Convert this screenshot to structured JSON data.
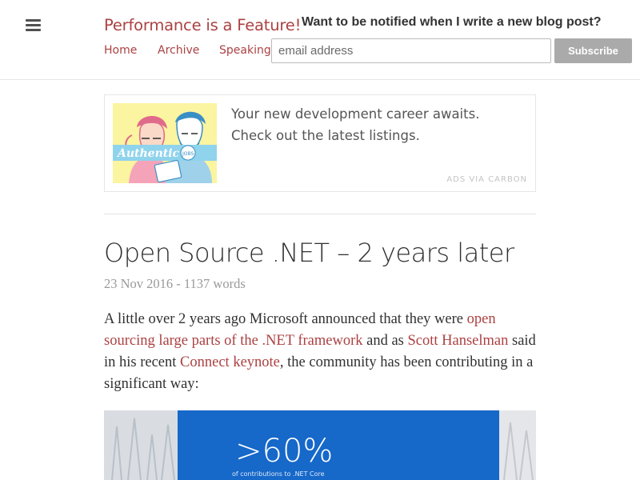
{
  "header": {
    "site_title": "Performance is a Feature!",
    "nav": [
      "Home",
      "Archive",
      "Speaking"
    ],
    "notify_question": "Want to be notified when I write a new blog post?",
    "email_placeholder": "email address",
    "subscribe_label": "Subscribe"
  },
  "ad": {
    "image_logo_text": "Authentic",
    "image_badge_text": "JOBS",
    "text": "Your new development career awaits. Check out the latest listings.",
    "via": "ADS VIA CARBON"
  },
  "post": {
    "title": "Open Source .NET – 2 years later",
    "meta": "23 Nov 2016 - 1137 words",
    "intro": {
      "t1": "A little over 2 years ago Microsoft announced that they were ",
      "link1": "open sourcing large parts of the .NET framework",
      "t2": " and as ",
      "link2": "Scott Hanselman",
      "t3": " said in his recent ",
      "link3": "Connect keynote",
      "t4": ", the community has been contributing in a significant way:"
    },
    "image": {
      "big_text": ">60%",
      "small_text": "of contributions to .NET Core"
    }
  },
  "colors": {
    "accent": "#ac4142",
    "button_grey": "#aaaaaa",
    "slide_blue": "#1668c9",
    "ad_yellow": "#fbf4a0"
  },
  "icons": {
    "menu": "hamburger-icon"
  }
}
